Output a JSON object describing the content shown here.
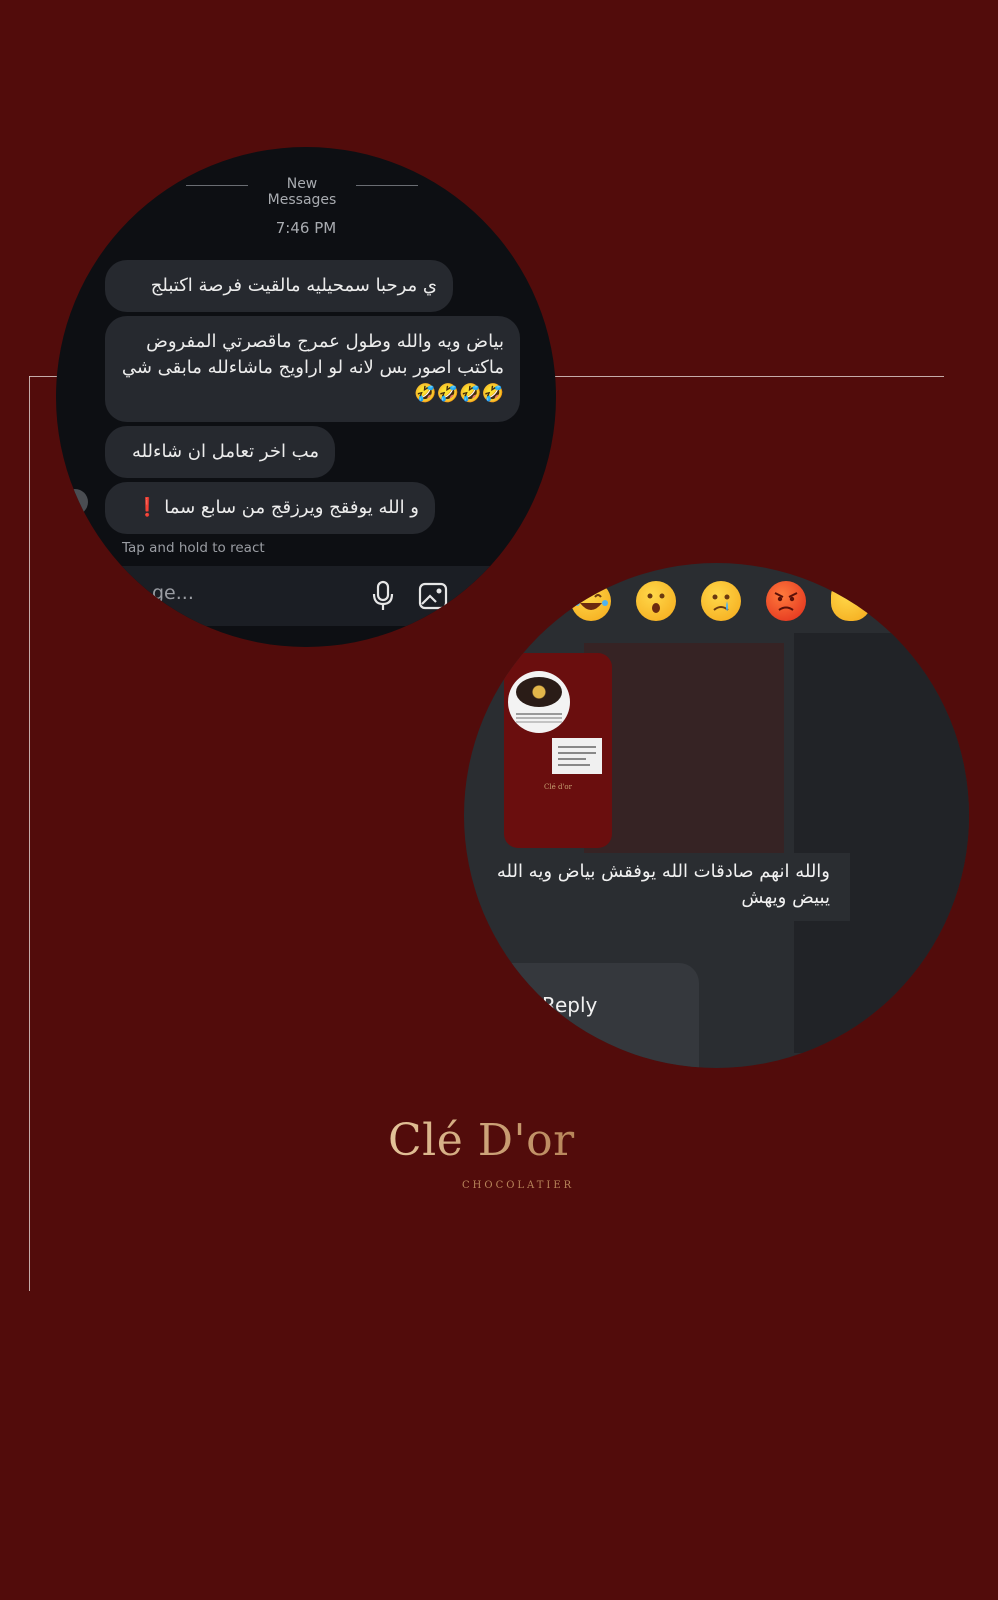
{
  "chat": {
    "divider_label": "New Messages",
    "time": "7:46 PM",
    "messages": [
      "ي مرحبا سمحيليه مالقيت فرصة اكتبلج",
      "بياض ويه والله وطول عمرج ماقصرتي المفروض ماكتب اصور بس لانه لو اراويج ماشاءلله مابقى شي 🤣🤣🤣🤣",
      "مب اخر تعامل ان شاءلله",
      "و الله يوفقج ويرزقج من سابع سما ❗"
    ],
    "react_hint": "Tap and hold to react",
    "input_placeholder": "ge..."
  },
  "story_reply": {
    "reactions": [
      "joy-emoji",
      "surprised-emoji",
      "crying-emoji",
      "angry-emoji",
      "clap-emoji"
    ],
    "story_brand_mini": "Clé d'or",
    "message": "والله انهم صادقات الله يوفقش بياض ويه الله يبيض ويهش",
    "reply_label": "Reply"
  },
  "brand": {
    "name": "Clé D'or",
    "tagline": "CHOCOLATIER"
  },
  "colors": {
    "background": "#520c0b",
    "bubble": "#26292f",
    "gold": "#c49a6a"
  }
}
